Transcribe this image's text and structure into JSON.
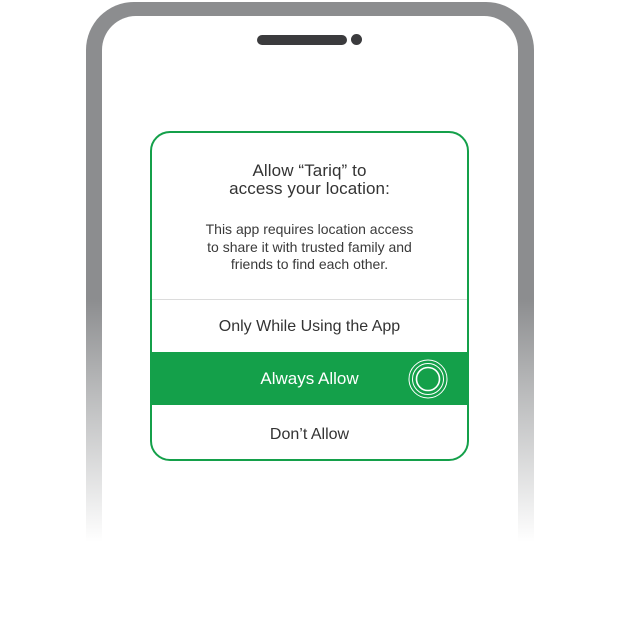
{
  "dialog": {
    "title_line1": "Allow “Tariq” to",
    "title_line2": "access your location:",
    "message_line1": "This app requires location access",
    "message_line2": "to share it with trusted family and",
    "message_line3": "friends to find each other.",
    "options": {
      "while_using": "Only While Using the App",
      "always": "Always Allow",
      "dont": "Don’t Allow"
    }
  },
  "colors": {
    "accent_green": "#14a04a",
    "phone_frame": "#8c8d8f",
    "speaker": "#3b3b3d",
    "text": "#333333"
  },
  "icons": {
    "tap_indicator": "touch-ripple-icon"
  }
}
